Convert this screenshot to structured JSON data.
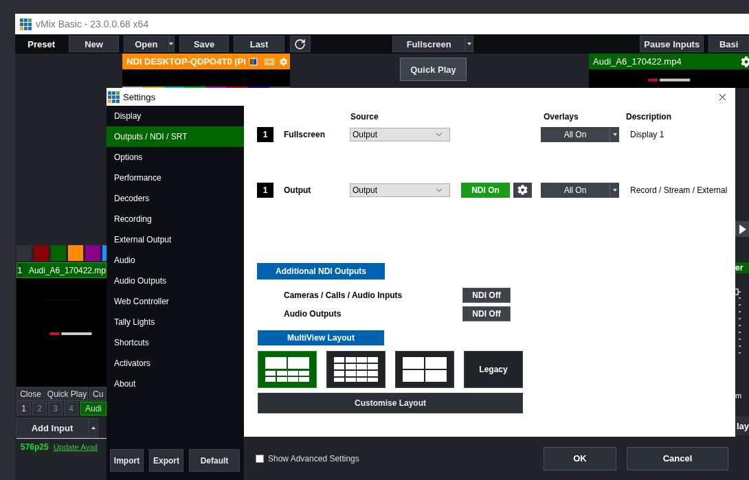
{
  "app_window": {
    "title": "vMix Basic - 23.0.0.68 x64"
  },
  "toolbar": [
    {
      "kind": "label",
      "label": "Preset"
    },
    {
      "kind": "button",
      "label": "New"
    },
    {
      "kind": "split",
      "label": "Open"
    },
    {
      "kind": "button",
      "label": "Save"
    },
    {
      "kind": "button",
      "label": "Last"
    },
    {
      "kind": "refresh"
    },
    {
      "kind": "split",
      "label": "Fullscreen"
    },
    {
      "kind": "button",
      "label": "Pause Inputs"
    },
    {
      "kind": "button",
      "label": "Basi"
    }
  ],
  "preview": {
    "title": "NDI DESKTOP-QDPO4T0 (Pl"
  },
  "quick_play": "Quick Play",
  "program": {
    "title": "Audi_A6_170422.mp4"
  },
  "color_swatches": [
    {
      "color": "#2e3338"
    },
    {
      "color": "#8b0000"
    },
    {
      "color": "#006400"
    },
    {
      "color": "#ff8c00"
    },
    {
      "color": "#8b008b"
    },
    {
      "color": "#1e90ff"
    }
  ],
  "input": {
    "number": "1",
    "title": "Audi_A6_170422.mp"
  },
  "input_buttons": [
    "Close",
    "Quick Play",
    "Cu"
  ],
  "overlay_numbers": [
    {
      "label": "1",
      "on": true
    },
    {
      "label": "2",
      "on": false
    },
    {
      "label": "3",
      "on": false
    },
    {
      "label": "4",
      "on": false
    }
  ],
  "overlay_input": "Audi",
  "add_input": "Add Input",
  "status_bar": {
    "format": "576p25",
    "update_link": "Update Avail"
  },
  "right_strip": {
    "header": "er",
    "label": "m",
    "button": "lay"
  },
  "settings": {
    "title": "Settings",
    "sidebar": [
      {
        "label": "Display",
        "selected": false
      },
      {
        "label": "Outputs / NDI / SRT",
        "selected": true
      },
      {
        "label": "Options",
        "selected": false
      },
      {
        "label": "Performance",
        "selected": false
      },
      {
        "label": "Decoders",
        "selected": false
      },
      {
        "label": "Recording",
        "selected": false
      },
      {
        "label": "External Output",
        "selected": false
      },
      {
        "label": "Audio",
        "selected": false
      },
      {
        "label": "Audio Outputs",
        "selected": false
      },
      {
        "label": "Web Controller",
        "selected": false
      },
      {
        "label": "Tally Lights",
        "selected": false
      },
      {
        "label": "Shortcuts",
        "selected": false
      },
      {
        "label": "Activators",
        "selected": false
      },
      {
        "label": "About",
        "selected": false
      }
    ],
    "sidebar_buttons": [
      "Import",
      "Export",
      "Default"
    ],
    "columns": {
      "source": "Source",
      "overlays": "Overlays",
      "description": "Description"
    },
    "outputs": [
      {
        "number": "1",
        "name": "Fullscreen",
        "source": "Output",
        "overlays": "All On",
        "description": "Display 1"
      },
      {
        "number": "1",
        "name": "Output",
        "source": "Output",
        "ndi": {
          "label": "NDI On",
          "on": true
        },
        "overlays": "All On",
        "description": "Record / Stream / External"
      }
    ],
    "additional_ndi": {
      "title": "Additional NDI Outputs",
      "rows": [
        {
          "label": "Cameras / Calls / Audio Inputs",
          "button": "NDI Off",
          "on": false
        },
        {
          "label": "Audio Outputs",
          "button": "NDI Off",
          "on": false
        }
      ]
    },
    "multiview": {
      "title": "MultiView Layout",
      "layouts": [
        {
          "kind": "big2_small8",
          "selected": true
        },
        {
          "kind": "grid16",
          "selected": false
        },
        {
          "kind": "grid4",
          "selected": false
        },
        {
          "kind": "text",
          "label": "Legacy",
          "selected": false
        }
      ],
      "customise": "Customise Layout"
    },
    "footer": {
      "show_advanced": {
        "label": "Show Advanced Settings",
        "checked": false
      },
      "ok": "OK",
      "cancel": "Cancel"
    }
  }
}
